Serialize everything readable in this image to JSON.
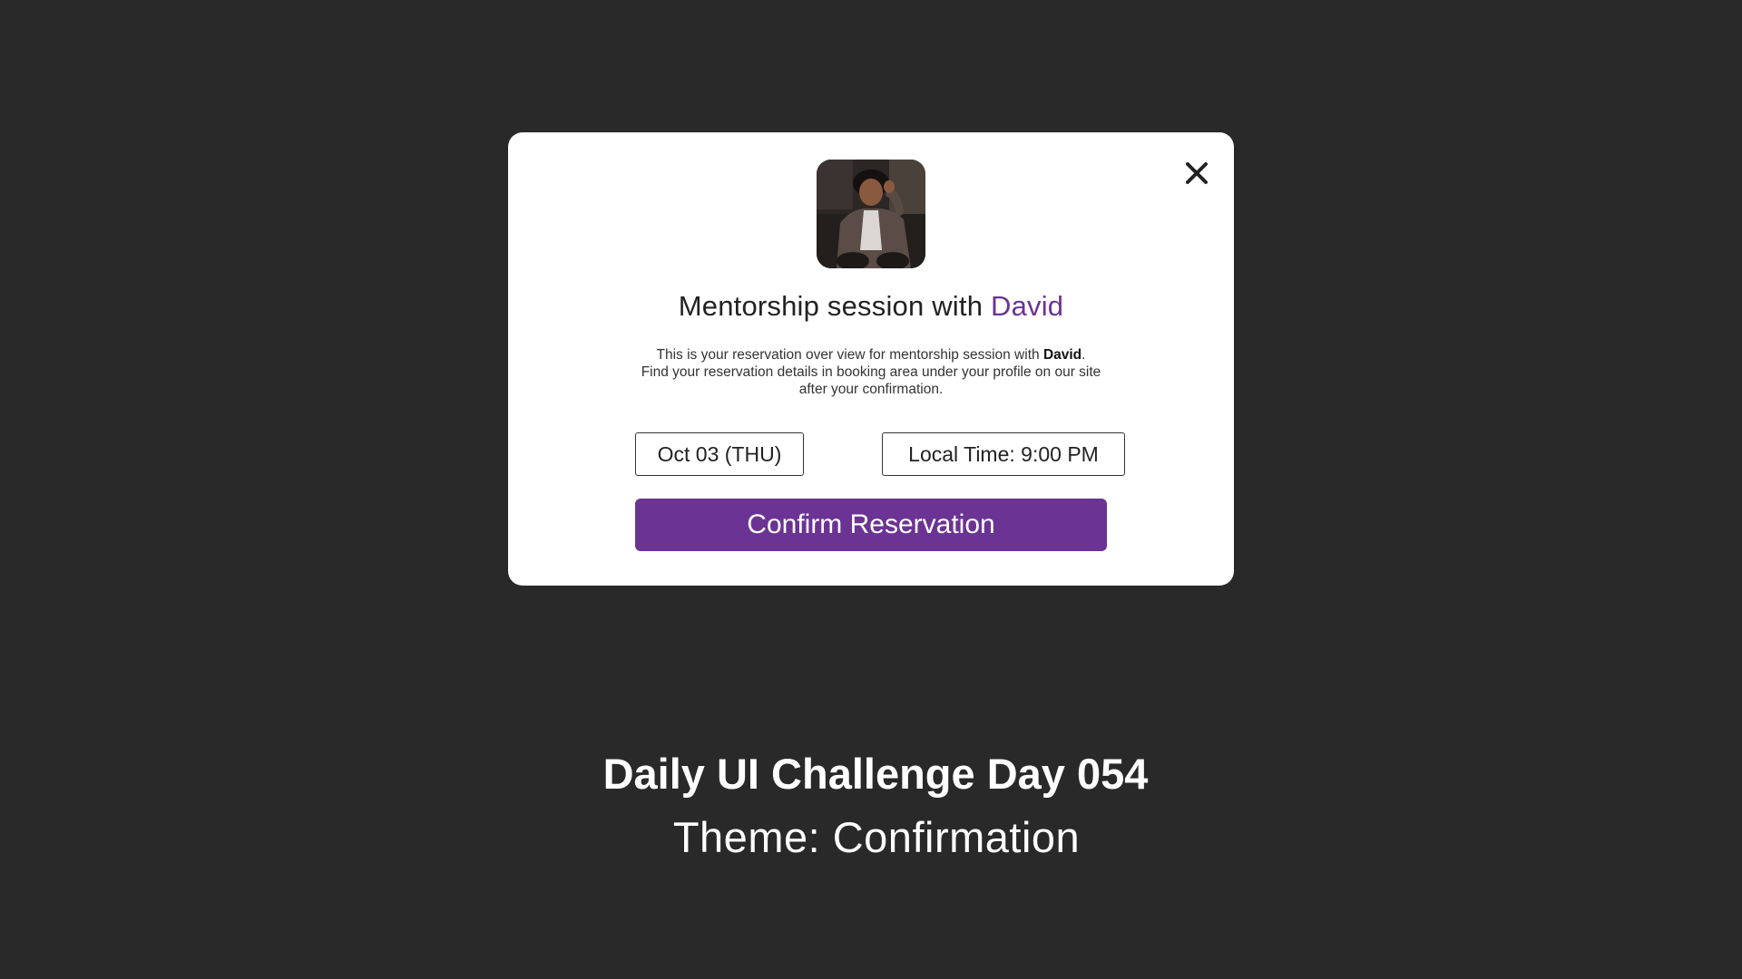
{
  "modal": {
    "title_prefix": "Mentorship session with",
    "title_name": "David",
    "desc_line1_prefix": "This is your reservation over view for mentorship session with",
    "desc_line1_name": "David",
    "desc_line1_suffix": ".",
    "desc_line2": "Find your reservation details in booking area under your profile on our site after your confirmation.",
    "date_label": "Oct 03 (THU)",
    "time_label": "Local Time: 9:00 PM",
    "confirm_label": "Confirm Reservation",
    "close_icon": "close-icon",
    "avatar_icon": "mentor-avatar"
  },
  "caption": {
    "title": "Daily UI Challenge Day 054",
    "subtitle": "Theme: Confirmation"
  },
  "colors": {
    "background": "#292929",
    "accent": "#6b3393",
    "modal": "#ffffff"
  }
}
